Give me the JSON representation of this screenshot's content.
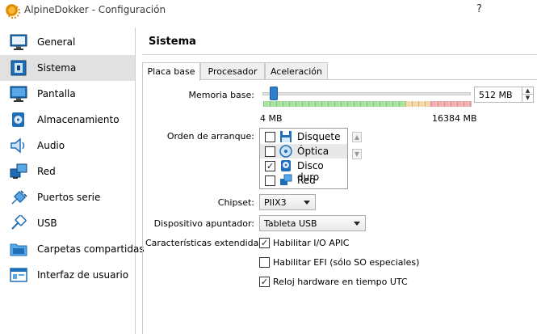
{
  "window": {
    "title": "AlpineDokker - Configuración",
    "help_glyph": "?",
    "close_glyph": "✕"
  },
  "sidebar": {
    "items": [
      {
        "label": "General",
        "icon": "monitor-icon"
      },
      {
        "label": "Sistema",
        "icon": "chip-icon"
      },
      {
        "label": "Pantalla",
        "icon": "display-icon"
      },
      {
        "label": "Almacenamiento",
        "icon": "disk-icon"
      },
      {
        "label": "Audio",
        "icon": "speaker-icon"
      },
      {
        "label": "Red",
        "icon": "network-icon"
      },
      {
        "label": "Puertos serie",
        "icon": "plug-icon"
      },
      {
        "label": "USB",
        "icon": "usb-icon"
      },
      {
        "label": "Carpetas compartidas",
        "icon": "folder-icon"
      },
      {
        "label": "Interfaz de usuario",
        "icon": "ui-icon"
      }
    ],
    "active_index": 1
  },
  "main": {
    "title": "Sistema",
    "tabs": [
      "Placa base",
      "Procesador",
      "Aceleración"
    ],
    "active_tab": 0
  },
  "motherboard": {
    "memory_label": "Memoria base:",
    "memory_value": "512 MB",
    "memory_min_label": "4 MB",
    "memory_max_label": "16384 MB",
    "memory_fraction": 0.03,
    "boot_order_label": "Orden de arranque:",
    "boot_items": [
      {
        "label": "Disquete",
        "checked": false,
        "icon": "floppy-icon"
      },
      {
        "label": "Óptica",
        "checked": false,
        "icon": "optical-disc-icon"
      },
      {
        "label": "Disco duro",
        "checked": true,
        "icon": "hard-disk-icon"
      },
      {
        "label": "Red",
        "checked": false,
        "icon": "network-icon"
      }
    ],
    "boot_selected_index": 1,
    "chipset_label": "Chipset:",
    "chipset_value": "PIIX3",
    "pointing_label": "Dispositivo apuntador:",
    "pointing_value": "Tableta USB",
    "features_label": "Características extendidas:",
    "features": [
      {
        "label": "Habilitar I/O APIC",
        "checked": true
      },
      {
        "label": "Habilitar EFI (sólo SO especiales)",
        "checked": false
      },
      {
        "label": "Reloj hardware en tiempo UTC",
        "checked": true
      }
    ]
  },
  "colors": {
    "slider_handle": "#2f7fd1",
    "zone_green": "#a9e3a1",
    "zone_red": "#f3b1b1",
    "active_item": "#e1e1e1"
  }
}
